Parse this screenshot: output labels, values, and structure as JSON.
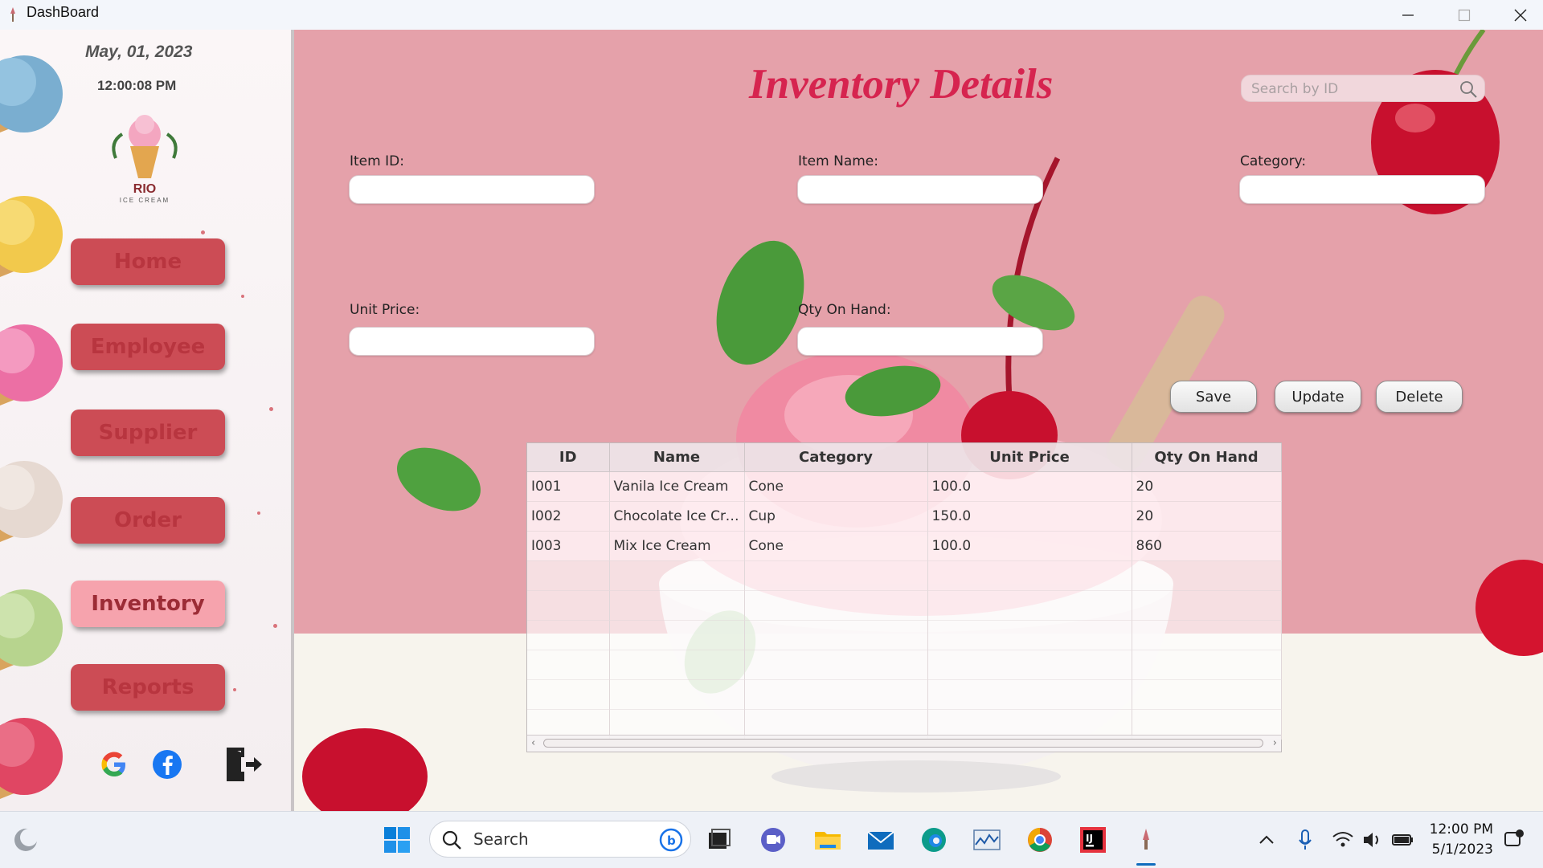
{
  "window": {
    "title": "DashBoard"
  },
  "sidebar": {
    "date": "May,  01, 2023",
    "time": "12:00:08 PM",
    "logo_text": "RIO",
    "logo_subtext": "ICE CREAM",
    "nav": [
      {
        "label": "Home",
        "active": false
      },
      {
        "label": "Employee",
        "active": false
      },
      {
        "label": "Supplier",
        "active": false
      },
      {
        "label": "Order",
        "active": false
      },
      {
        "label": "Inventory",
        "active": true
      },
      {
        "label": "Reports",
        "active": false
      }
    ],
    "social_icons": [
      "google-icon",
      "facebook-icon"
    ],
    "logout_icon": "logout-icon"
  },
  "main": {
    "title": "Inventory Details",
    "search": {
      "placeholder": "Search by ID",
      "value": ""
    },
    "fields": {
      "item_id": {
        "label": "Item ID:",
        "value": ""
      },
      "item_name": {
        "label": "Item Name:",
        "value": ""
      },
      "category": {
        "label": "Category:",
        "value": ""
      },
      "unit_price": {
        "label": "Unit Price:",
        "value": ""
      },
      "qty_on_hand": {
        "label": "Qty On Hand:",
        "value": ""
      }
    },
    "buttons": {
      "save": "Save",
      "update": "Update",
      "delete": "Delete"
    },
    "table": {
      "columns": [
        "ID",
        "Name",
        "Category",
        "Unit Price",
        "Qty On Hand"
      ],
      "rows": [
        [
          "I001",
          "Vanila Ice Cream",
          "Cone",
          "100.0",
          "20"
        ],
        [
          "I002",
          "Chocolate Ice Cre...",
          "Cup",
          "150.0",
          "20"
        ],
        [
          "I003",
          "Mix Ice Cream",
          "Cone",
          "100.0",
          "860"
        ]
      ]
    }
  },
  "taskbar": {
    "search_label": "Search",
    "time": "12:00 PM",
    "date": "5/1/2023"
  },
  "colors": {
    "accent_pink": "#d6244f",
    "nav_button": "#cc4c55",
    "nav_active": "#f6a3ad",
    "main_bg": "#e5a1aa"
  }
}
